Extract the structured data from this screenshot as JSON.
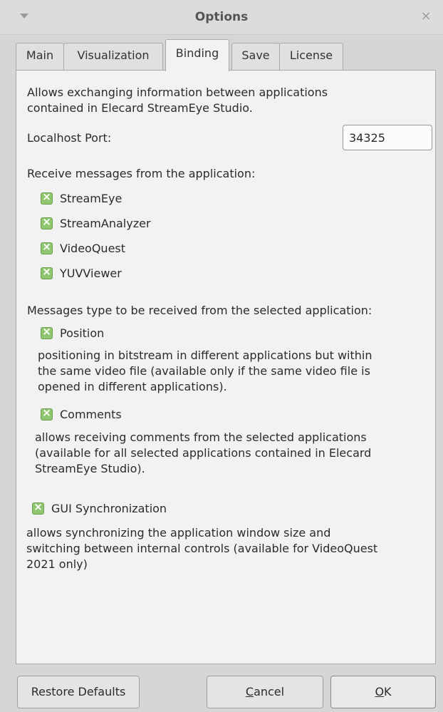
{
  "window": {
    "title": "Options",
    "close_glyph": "×",
    "menu_icon": "chevron-down-icon"
  },
  "tabs": [
    {
      "label": "Main",
      "active": false
    },
    {
      "label": "Visualization",
      "active": false
    },
    {
      "label": "Binding",
      "active": true
    },
    {
      "label": "Save",
      "active": false
    },
    {
      "label": "License",
      "active": false
    }
  ],
  "binding": {
    "intro": "Allows exchanging information between applications",
    "intro2": "contained in Elecard StreamEye Studio.",
    "port_label": "Localhost Port:",
    "port_value": "34325",
    "receive_label": "Receive messages from the application:",
    "apps": [
      {
        "label": "StreamEye",
        "checked": true
      },
      {
        "label": "StreamAnalyzer",
        "checked": true
      },
      {
        "label": "VideoQuest",
        "checked": true
      },
      {
        "label": "YUVViewer",
        "checked": true
      }
    ],
    "msgtype_label": "Messages type to be received from the selected application:",
    "position": {
      "label": "Position",
      "checked": true,
      "desc1": " positioning in bitstream in different applications but within",
      "desc2": "the same video file (available only if the same video file is",
      "desc3": "opened in different applications)."
    },
    "comments": {
      "label": "Comments",
      "checked": true,
      "desc1": " allows receiving comments from the selected applications",
      "desc2": "(available for all selected applications contained in Elecard",
      "desc3": "StreamEye Studio)."
    },
    "gui_sync": {
      "label": "GUI Synchronization",
      "checked": true,
      "desc1": " allows synchronizing the application window size and",
      "desc2": "switching between internal controls (available for VideoQuest",
      "desc3": "2021 only)"
    }
  },
  "buttons": {
    "restore": "Restore Defaults",
    "cancel_mnemonic": "C",
    "cancel_rest": "ancel",
    "ok_mnemonic": "O",
    "ok_rest": "K"
  },
  "colors": {
    "checkbox_fill": "#8fc66f",
    "window_bg": "#d6d6d6",
    "panel_bg": "#f2f2f2"
  }
}
